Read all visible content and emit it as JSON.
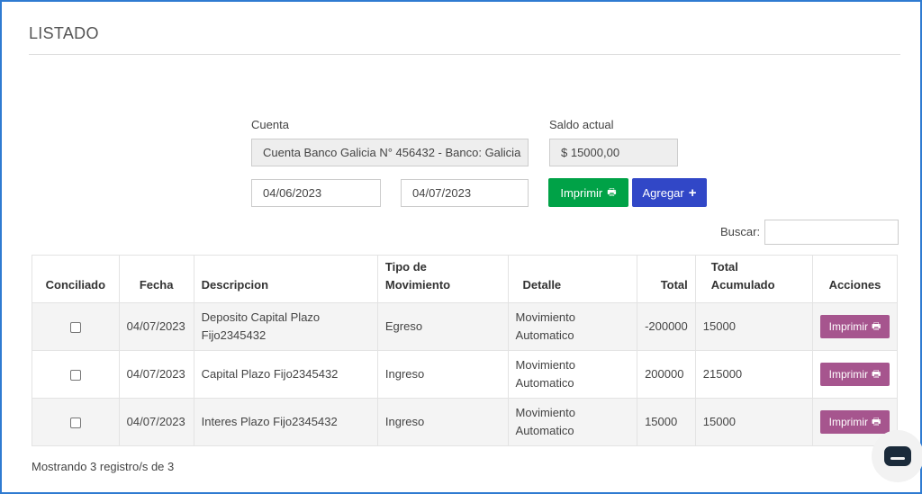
{
  "page": {
    "title": "LISTADO"
  },
  "form": {
    "cuenta_label": "Cuenta",
    "cuenta_value": "Cuenta Banco Galicia N° 456432 - Banco:  Galicia",
    "saldo_label": "Saldo actual",
    "saldo_value": "$ 15000,00",
    "fecha_desde": "04/06/2023",
    "fecha_hasta": "04/07/2023",
    "imprimir_label": "Imprimir",
    "agregar_label": "Agregar"
  },
  "search": {
    "label": "Buscar:",
    "value": ""
  },
  "table": {
    "headers": {
      "conciliado": "Conciliado",
      "fecha": "Fecha",
      "descripcion": "Descripcion",
      "tipo_1": "Tipo de",
      "tipo_2": "Movimiento",
      "detalle": "Detalle",
      "total": "Total",
      "acum_1": "Total",
      "acum_2": "Acumulado",
      "acciones": "Acciones"
    },
    "rows": [
      {
        "conciliado": false,
        "fecha": "04/07/2023",
        "desc_1": "Deposito Capital Plazo",
        "desc_2": "Fijo2345432",
        "tipo": "Egreso",
        "det_1": "Movimiento",
        "det_2": "Automatico",
        "total": "-200000",
        "acumulado": "15000",
        "accion": "Imprimir"
      },
      {
        "conciliado": false,
        "fecha": "04/07/2023",
        "desc_1": "Capital Plazo Fijo2345432",
        "desc_2": "",
        "tipo": "Ingreso",
        "det_1": "Movimiento",
        "det_2": "Automatico",
        "total": "200000",
        "acumulado": "215000",
        "accion": "Imprimir"
      },
      {
        "conciliado": false,
        "fecha": "04/07/2023",
        "desc_1": "Interes Plazo Fijo2345432",
        "desc_2": "",
        "tipo": "Ingreso",
        "det_1": "Movimiento",
        "det_2": "Automatico",
        "total": "15000",
        "acumulado": "15000",
        "accion": "Imprimir"
      }
    ]
  },
  "footer": {
    "text": "Mostrando 3 registro/s de 3"
  },
  "colors": {
    "primary_green": "#00a247",
    "primary_blue": "#3147c7",
    "row_action": "#a6558e",
    "frame_border": "#2f7bd1"
  },
  "icons": {
    "print": "printer-icon",
    "add": "plus-icon",
    "chat": "chat-icon"
  }
}
